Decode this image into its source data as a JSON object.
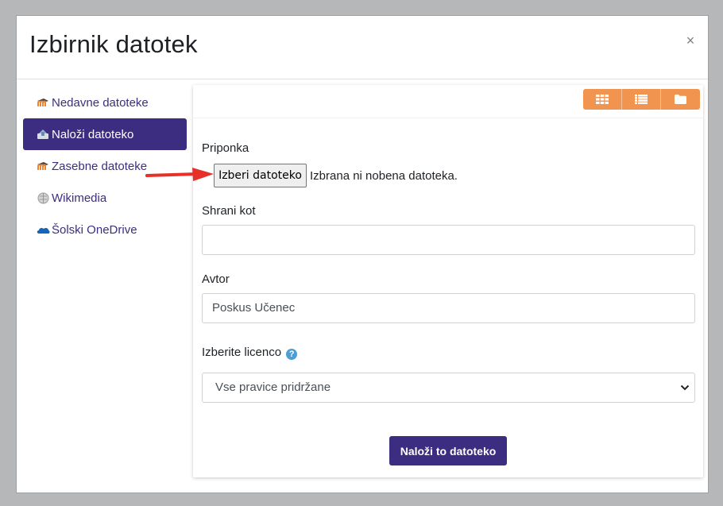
{
  "dialog": {
    "title": "Izbirnik datotek",
    "close_glyph": "×"
  },
  "sidebar": {
    "items": [
      {
        "label": "Nedavne datoteke",
        "icon": "moodle-hat-icon",
        "active": false
      },
      {
        "label": "Naloži datoteko",
        "icon": "upload-icon",
        "active": true
      },
      {
        "label": "Zasebne datoteke",
        "icon": "moodle-hat-icon",
        "active": false
      },
      {
        "label": "Wikimedia",
        "icon": "wikipedia-globe-icon",
        "active": false
      },
      {
        "label": "Šolski OneDrive",
        "icon": "onedrive-cloud-icon",
        "active": false
      }
    ]
  },
  "toolbar": {
    "views": [
      "grid-view-icon",
      "list-view-icon",
      "folder-view-icon"
    ],
    "accent": "#f0944f"
  },
  "form": {
    "attachment_label": "Priponka",
    "choose_file_button": "Izberi datoteko",
    "no_file_text": "Izbrana ni nobena datoteka.",
    "save_as_label": "Shrani kot",
    "save_as_value": "",
    "author_label": "Avtor",
    "author_value": "Poskus Učenec",
    "license_label": "Izberite licenco",
    "license_value": "Vse pravice pridržane",
    "upload_button": "Naloži to datoteko"
  },
  "colors": {
    "primary": "#3c2d80",
    "arrow": "#e8302a"
  }
}
